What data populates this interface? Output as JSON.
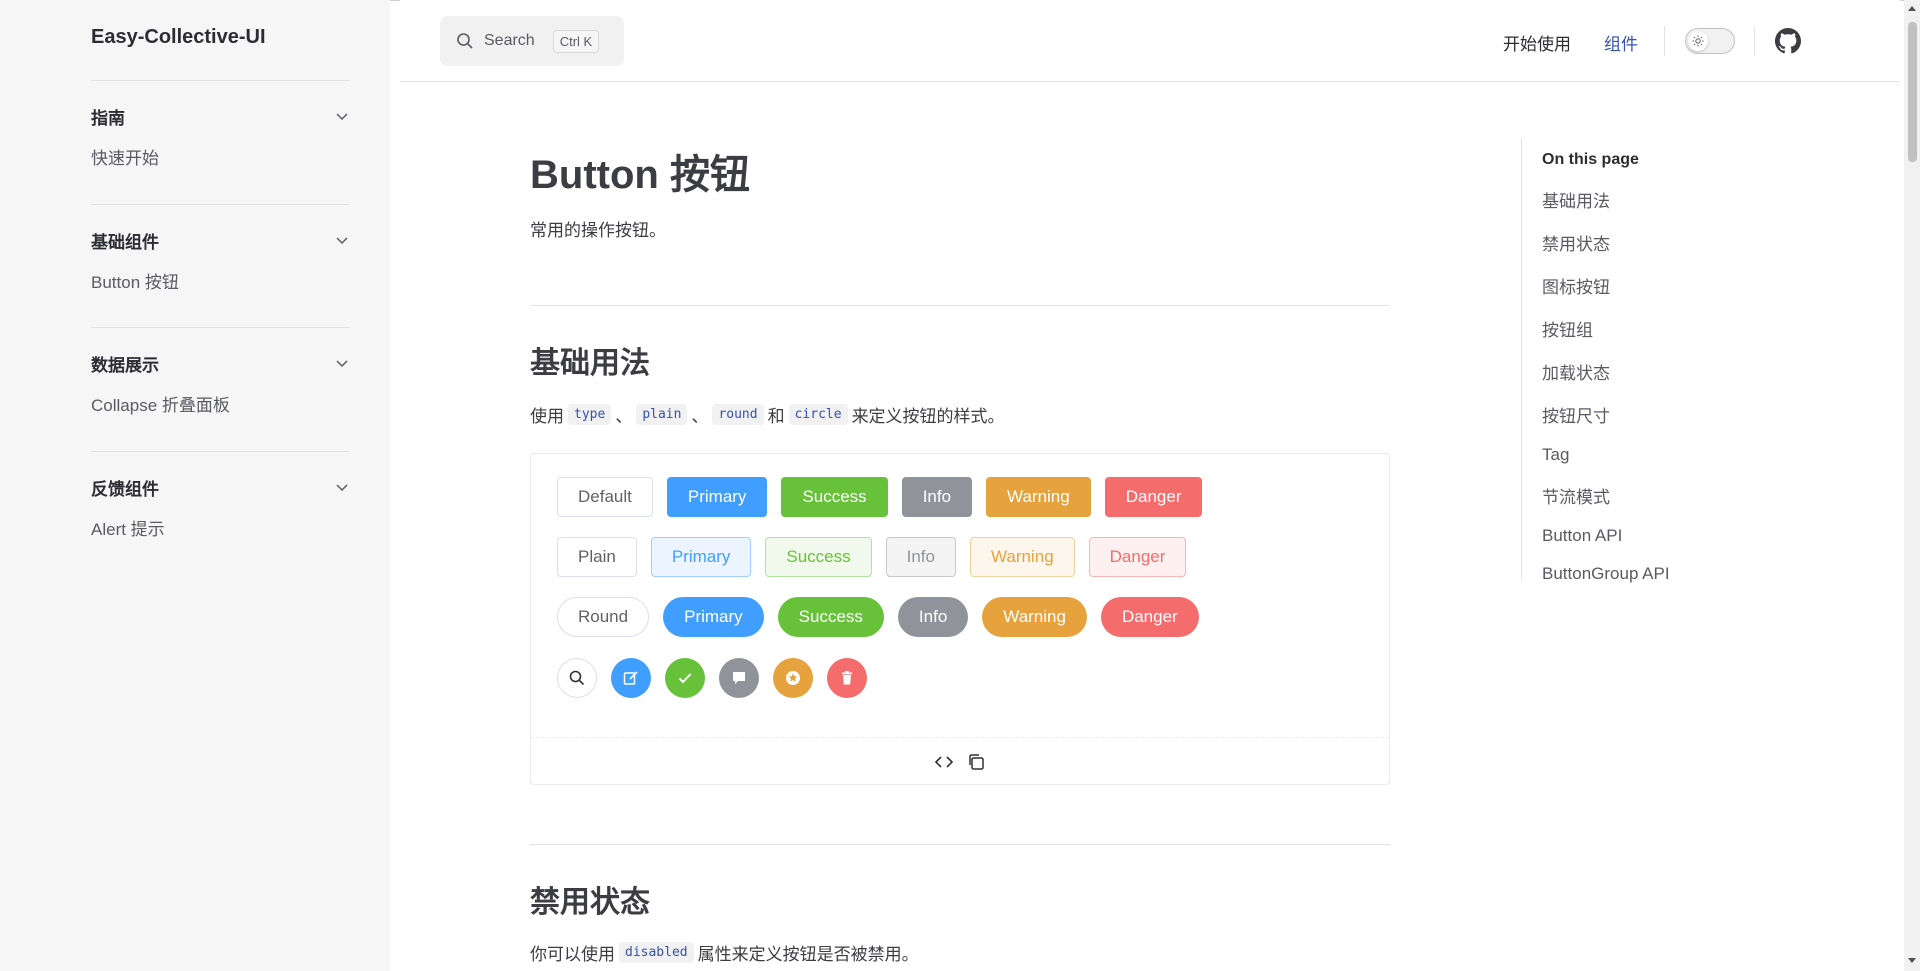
{
  "sidebar": {
    "logo": "Easy-Collective-UI",
    "groups": [
      {
        "title": "指南",
        "item": "快速开始"
      },
      {
        "title": "基础组件",
        "item": "Button 按钮"
      },
      {
        "title": "数据展示",
        "item": "Collapse 折叠面板"
      },
      {
        "title": "反馈组件",
        "item": "Alert 提示"
      }
    ]
  },
  "header": {
    "search_label": "Search",
    "search_shortcut": "Ctrl K",
    "nav": [
      "开始使用",
      "组件"
    ],
    "active_nav": "组件"
  },
  "main": {
    "title": "Button 按钮",
    "lead": "常用的操作按钮。",
    "section1": {
      "title": "基础用法",
      "desc_prefix": "使用",
      "code1": "type",
      "sep1": "、",
      "code2": "plain",
      "sep2": "、",
      "code3": "round",
      "sep3": "和",
      "code4": "circle",
      "desc_suffix": "来定义按钮的样式。"
    },
    "demo": {
      "row1": [
        "Default",
        "Primary",
        "Success",
        "Info",
        "Warning",
        "Danger"
      ],
      "row2": [
        "Plain",
        "Primary",
        "Success",
        "Info",
        "Warning",
        "Danger"
      ],
      "row3": [
        "Round",
        "Primary",
        "Success",
        "Info",
        "Warning",
        "Danger"
      ],
      "row4_icons": [
        "search-icon",
        "edit-icon",
        "check-icon",
        "message-icon",
        "star-icon",
        "delete-icon"
      ]
    },
    "section2": {
      "title": "禁用状态",
      "desc_prefix": "你可以使用",
      "code1": "disabled",
      "desc_suffix": "属性来定义按钮是否被禁用。"
    }
  },
  "toc": {
    "title": "On this page",
    "items": [
      "基础用法",
      "禁用状态",
      "图标按钮",
      "按钮组",
      "加载状态",
      "按钮尺寸",
      "Tag",
      "节流模式",
      "Button API",
      "ButtonGroup API"
    ]
  },
  "colors": {
    "primary": "#409eff",
    "success": "#67c23a",
    "info": "#909399",
    "warning": "#e6a23c",
    "danger": "#f56c6c",
    "brand_link": "#3451b2"
  }
}
